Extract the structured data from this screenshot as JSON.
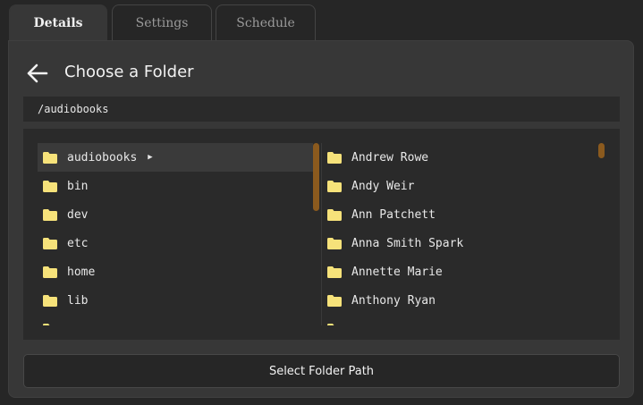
{
  "tabs": [
    {
      "label": "Details",
      "active": true
    },
    {
      "label": "Settings",
      "active": false
    },
    {
      "label": "Schedule",
      "active": false
    }
  ],
  "header": {
    "title": "Choose a Folder",
    "back_icon": "arrow-left-icon"
  },
  "current_path": "/audiobooks",
  "left_column": {
    "items": [
      {
        "label": "audiobooks",
        "selected": true,
        "has_children_indicator": true
      },
      {
        "label": "bin"
      },
      {
        "label": "dev"
      },
      {
        "label": "etc"
      },
      {
        "label": "home"
      },
      {
        "label": "lib"
      },
      {
        "label": "..."
      }
    ]
  },
  "right_column": {
    "items": [
      {
        "label": "Andrew Rowe"
      },
      {
        "label": "Andy Weir"
      },
      {
        "label": "Ann Patchett"
      },
      {
        "label": "Anna Smith Spark"
      },
      {
        "label": "Annette Marie"
      },
      {
        "label": "Anthony Ryan"
      },
      {
        "label": "..."
      }
    ]
  },
  "footer": {
    "select_label": "Select Folder Path"
  },
  "colors": {
    "accent_scrollbar": "#8b5a1e",
    "folder_icon": "#f6e27a",
    "panel": "#373737",
    "background": "#262626"
  }
}
